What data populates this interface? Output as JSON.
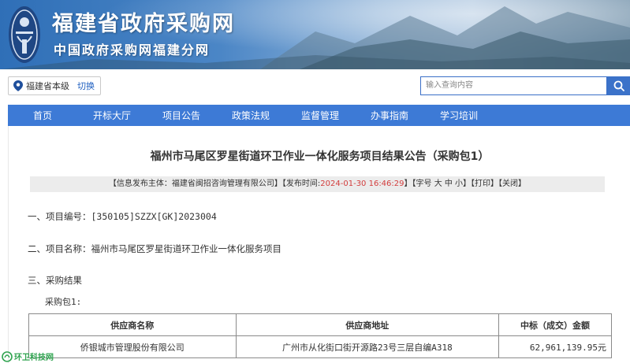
{
  "banner": {
    "title": "福建省政府采购网",
    "subtitle": "中国政府采购网福建分网"
  },
  "location": {
    "region": "福建省本级",
    "switch_label": "切换"
  },
  "search": {
    "placeholder": "输入查询内容"
  },
  "nav": {
    "items": [
      "首页",
      "开标大厅",
      "项目公告",
      "政策法规",
      "监督管理",
      "办事指南",
      "学习培训"
    ]
  },
  "document": {
    "title": "福州市马尾区罗星街道环卫作业一体化服务项目结果公告（采购包1）",
    "info_prefix": "【信息发布主体：福建省闽招咨询管理有限公司】【发布时间:",
    "publish_time": "2024-01-30 16:46:29",
    "info_suffix": "】【字号 大 中 小】【打印】【关闭】",
    "section1": "一、项目编号：[350105]SZZX[GK]2023004",
    "section2": "二、项目名称：福州市马尾区罗星街道环卫作业一体化服务项目",
    "section3": "三、采购结果",
    "package_label": "采购包1:",
    "table": {
      "headers": [
        "供应商名称",
        "供应商地址",
        "中标（成交）金额"
      ],
      "rows": [
        [
          "侨银城市管理股份有限公司",
          "广州市从化街口街开源路23号三层自编A318",
          "62,961,139.95元"
        ]
      ]
    }
  },
  "watermark": {
    "text": "环卫科技网"
  },
  "colors": {
    "nav_bg": "#3d7ad6",
    "accent_link": "#1e5fc0",
    "publish_time": "#d23c3c",
    "watermark": "#2fa34f"
  }
}
